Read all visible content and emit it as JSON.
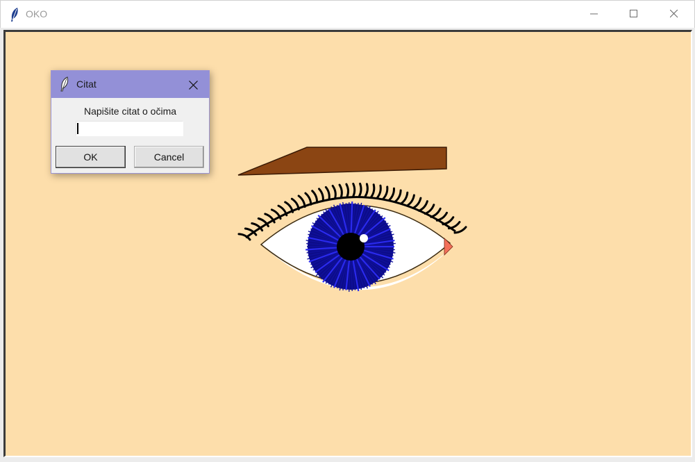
{
  "window": {
    "title": "OKO",
    "icon": "feather-icon",
    "controls": [
      "minimize-icon",
      "maximize-icon",
      "close-icon"
    ]
  },
  "canvas": {
    "background": "#fddeab",
    "drawing": {
      "eyebrow_color": "#8b4513",
      "iris_color": "#1010a0",
      "pupil_color": "#000000",
      "tear_duct_color": "#f2705a",
      "sclera_color": "#ffffff",
      "lash_color": "#000000"
    }
  },
  "dialog": {
    "title": "Citat",
    "icon": "feather-icon",
    "prompt": "Napišite citat o očima",
    "input_value": "",
    "ok_label": "OK",
    "cancel_label": "Cancel",
    "titlebar_color": "#9390d7"
  }
}
